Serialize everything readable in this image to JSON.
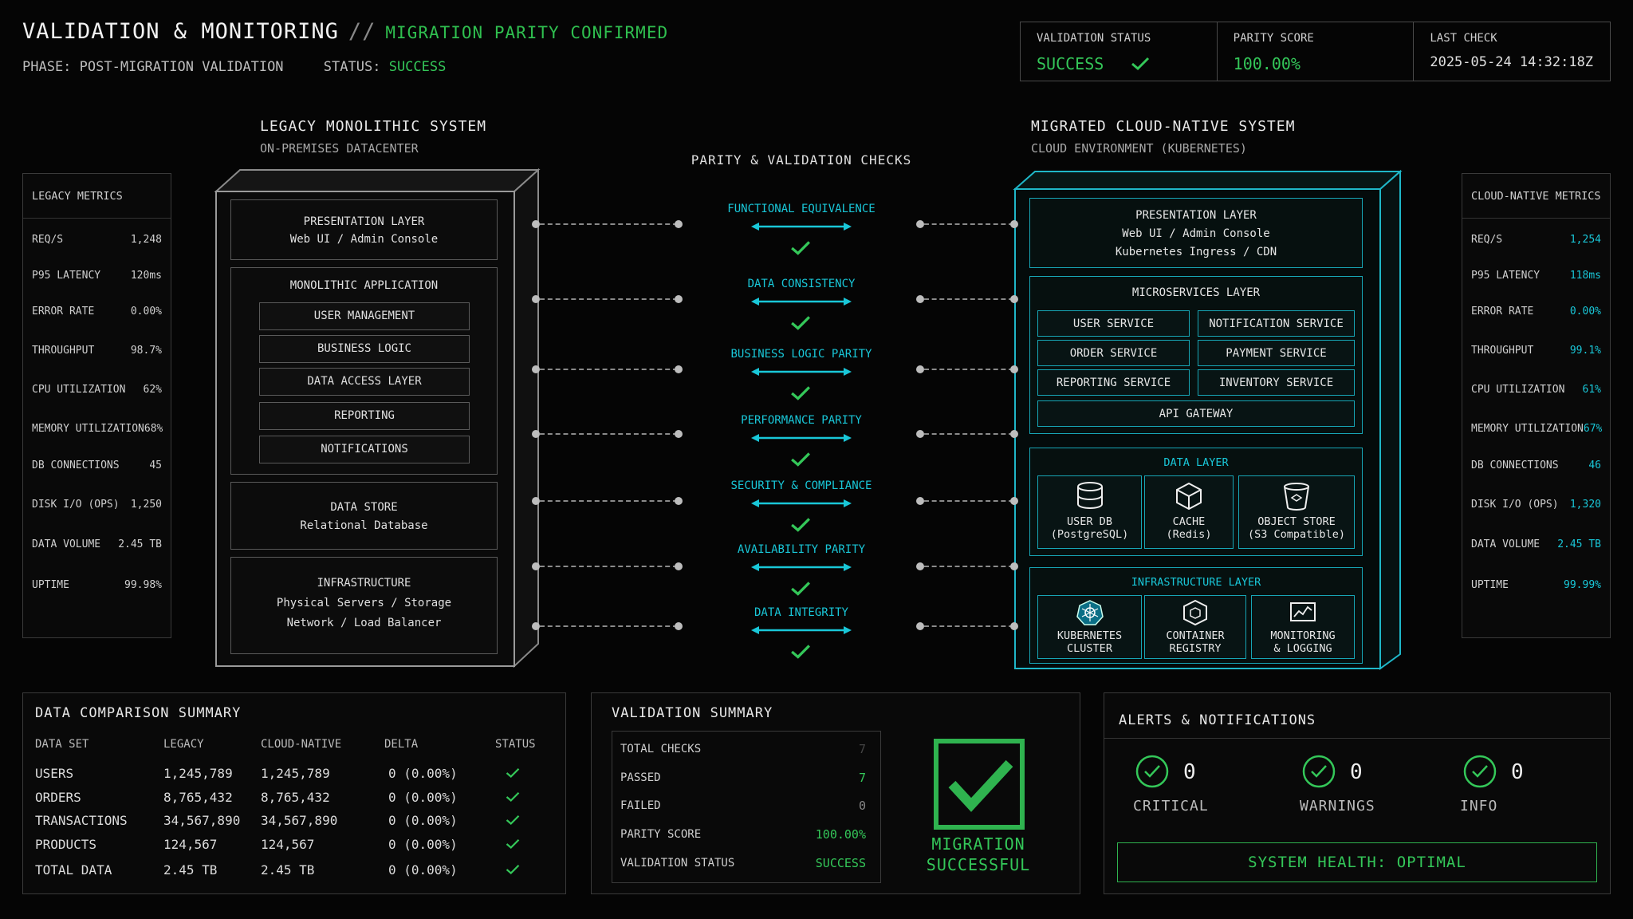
{
  "header": {
    "title": "VALIDATION & MONITORING",
    "separator": "//",
    "subtitle": "MIGRATION PARITY CONFIRMED",
    "phase_label": "PHASE:",
    "phase_value": "POST-MIGRATION VALIDATION",
    "status_label": "STATUS:",
    "status_value": "SUCCESS"
  },
  "status_box": {
    "validation_status_label": "VALIDATION STATUS",
    "validation_status_value": "SUCCESS",
    "parity_score_label": "PARITY SCORE",
    "parity_score_value": "100.00%",
    "last_check_label": "LAST CHECK",
    "last_check_value": "2025-05-24 14:32:18Z"
  },
  "legacy": {
    "title": "LEGACY MONOLITHIC SYSTEM",
    "subtitle": "ON-PREMISES DATACENTER",
    "presentation": {
      "title": "PRESENTATION LAYER",
      "line1": "Web UI / Admin Console"
    },
    "app": {
      "title": "MONOLITHIC APPLICATION",
      "modules": [
        "USER MANAGEMENT",
        "BUSINESS LOGIC",
        "DATA ACCESS LAYER",
        "REPORTING",
        "NOTIFICATIONS"
      ]
    },
    "datastore": {
      "title": "DATA STORE",
      "line1": "Relational Database"
    },
    "infra": {
      "title": "INFRASTRUCTURE",
      "line1": "Physical Servers / Storage",
      "line2": "Network / Load Balancer"
    }
  },
  "legacy_metrics": {
    "title": "LEGACY METRICS",
    "rows": [
      {
        "label": "REQ/S",
        "value": "1,248"
      },
      {
        "label": "P95 LATENCY",
        "value": "120ms"
      },
      {
        "label": "ERROR RATE",
        "value": "0.00%"
      },
      {
        "label": "THROUGHPUT",
        "value": "98.7%"
      },
      {
        "label": "CPU UTILIZATION",
        "value": "62%"
      },
      {
        "label": "MEMORY UTILIZATION",
        "value": "68%"
      },
      {
        "label": "DB CONNECTIONS",
        "value": "45"
      },
      {
        "label": "DISK I/O (OPS)",
        "value": "1,250"
      },
      {
        "label": "DATA VOLUME",
        "value": "2.45 TB"
      },
      {
        "label": "UPTIME",
        "value": "99.98%"
      }
    ]
  },
  "cloud": {
    "title": "MIGRATED CLOUD-NATIVE SYSTEM",
    "subtitle": "CLOUD ENVIRONMENT (KUBERNETES)",
    "presentation": {
      "title": "PRESENTATION LAYER",
      "line1": "Web UI / Admin Console",
      "line2": "Kubernetes Ingress / CDN"
    },
    "microservices": {
      "title": "MICROSERVICES LAYER",
      "services": [
        "USER SERVICE",
        "NOTIFICATION SERVICE",
        "ORDER SERVICE",
        "PAYMENT SERVICE",
        "REPORTING SERVICE",
        "INVENTORY SERVICE"
      ],
      "gateway": "API GATEWAY"
    },
    "data_layer": {
      "title": "DATA LAYER",
      "tiles": [
        {
          "icon": "database-icon",
          "line1": "USER DB",
          "line2": "(PostgreSQL)"
        },
        {
          "icon": "cube-icon",
          "line1": "CACHE",
          "line2": "(Redis)"
        },
        {
          "icon": "bucket-icon",
          "line1": "OBJECT STORE",
          "line2": "(S3 Compatible)"
        }
      ]
    },
    "infra_layer": {
      "title": "INFRASTRUCTURE LAYER",
      "tiles": [
        {
          "icon": "kubernetes-icon",
          "line1": "KUBERNETES",
          "line2": "CLUSTER"
        },
        {
          "icon": "container-icon",
          "line1": "CONTAINER",
          "line2": "REGISTRY"
        },
        {
          "icon": "chart-icon",
          "line1": "MONITORING",
          "line2": "& LOGGING"
        }
      ]
    }
  },
  "cloud_metrics": {
    "title": "CLOUD-NATIVE METRICS",
    "rows": [
      {
        "label": "REQ/S",
        "value": "1,254"
      },
      {
        "label": "P95 LATENCY",
        "value": "118ms"
      },
      {
        "label": "ERROR RATE",
        "value": "0.00%"
      },
      {
        "label": "THROUGHPUT",
        "value": "99.1%"
      },
      {
        "label": "CPU UTILIZATION",
        "value": "61%"
      },
      {
        "label": "MEMORY UTILIZATION",
        "value": "67%"
      },
      {
        "label": "DB CONNECTIONS",
        "value": "46"
      },
      {
        "label": "DISK I/O (OPS)",
        "value": "1,320"
      },
      {
        "label": "DATA VOLUME",
        "value": "2.45 TB"
      },
      {
        "label": "UPTIME",
        "value": "99.99%"
      }
    ]
  },
  "checks": {
    "title": "PARITY & VALIDATION CHECKS",
    "items": [
      "FUNCTIONAL EQUIVALENCE",
      "DATA CONSISTENCY",
      "BUSINESS LOGIC PARITY",
      "PERFORMANCE PARITY",
      "SECURITY & COMPLIANCE",
      "AVAILABILITY PARITY",
      "DATA INTEGRITY"
    ]
  },
  "data_comparison": {
    "title": "DATA COMPARISON SUMMARY",
    "columns": [
      "DATA SET",
      "LEGACY",
      "CLOUD-NATIVE",
      "DELTA",
      "STATUS"
    ],
    "rows": [
      [
        "USERS",
        "1,245,789",
        "1,245,789",
        "0 (0.00%)"
      ],
      [
        "ORDERS",
        "8,765,432",
        "8,765,432",
        "0 (0.00%)"
      ],
      [
        "TRANSACTIONS",
        "34,567,890",
        "34,567,890",
        "0 (0.00%)"
      ],
      [
        "PRODUCTS",
        "124,567",
        "124,567",
        "0 (0.00%)"
      ],
      [
        "TOTAL DATA",
        "2.45 TB",
        "2.45 TB",
        "0 (0.00%)"
      ]
    ]
  },
  "validation_summary": {
    "title": "VALIDATION SUMMARY",
    "rows": [
      {
        "label": "TOTAL CHECKS",
        "value": "7"
      },
      {
        "label": "PASSED",
        "value": "7"
      },
      {
        "label": "FAILED",
        "value": "0"
      },
      {
        "label": "PARITY SCORE",
        "value": "100.00%"
      },
      {
        "label": "VALIDATION STATUS",
        "value": "SUCCESS"
      }
    ],
    "badge_line1": "MIGRATION",
    "badge_line2": "SUCCESSFUL"
  },
  "alerts": {
    "title": "ALERTS & NOTIFICATIONS",
    "items": [
      {
        "count": "0",
        "label": "CRITICAL"
      },
      {
        "count": "0",
        "label": "WARNINGS"
      },
      {
        "count": "0",
        "label": "INFO"
      }
    ],
    "health": "SYSTEM HEALTH: OPTIMAL"
  },
  "colors": {
    "accent_green": "#34c759",
    "accent_cyan": "#19c7d8",
    "background": "#050505"
  }
}
